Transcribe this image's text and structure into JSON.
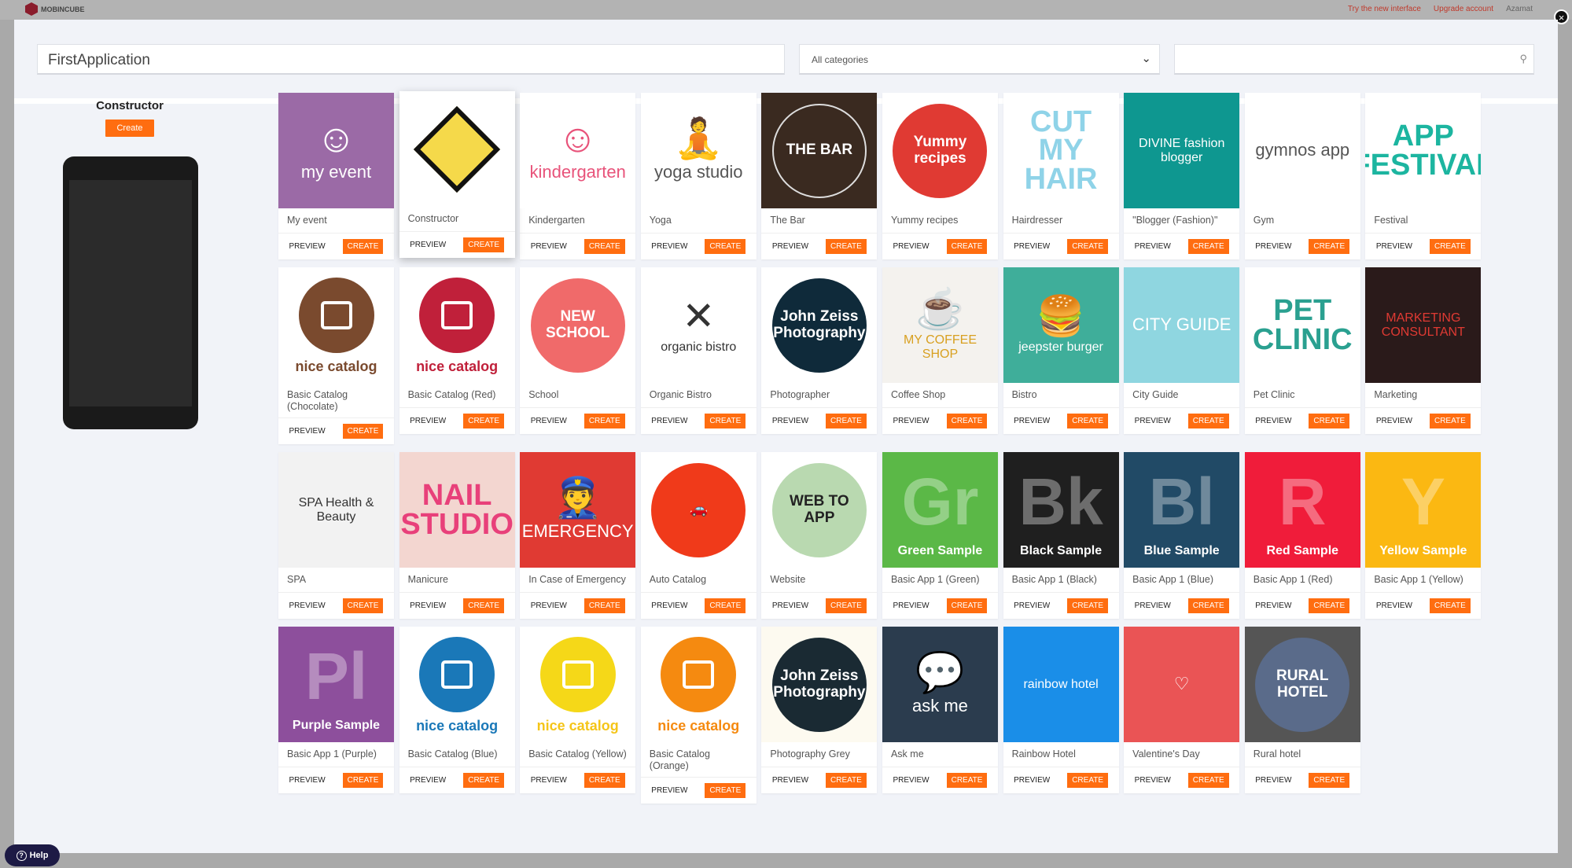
{
  "topbar": {
    "brand": "MOBINCUBE",
    "try_new": "Try the new interface",
    "upgrade": "Upgrade account",
    "user": "Azamat"
  },
  "header": {
    "app_name": "FirstApplication",
    "category": "All categories",
    "search_placeholder": ""
  },
  "left": {
    "title": "Constructor",
    "create": "Create"
  },
  "help": "Help",
  "buttons": {
    "preview": "PREVIEW",
    "create": "CREATE"
  },
  "accent": "#ff6d10",
  "cards": [
    {
      "title": "My event",
      "thumb": {
        "bg": "#9b6aa6",
        "kind": "text",
        "text": "my event",
        "color": "#fff",
        "icon": "☺"
      }
    },
    {
      "title": "Constructor",
      "raised": true,
      "thumb": {
        "bg": "#fff",
        "kind": "diamond",
        "text": "",
        "color": "#111"
      }
    },
    {
      "title": "Kindergarten",
      "thumb": {
        "bg": "#fff",
        "kind": "text",
        "text": "kindergarten",
        "color": "#e8537a",
        "icon": "☺"
      }
    },
    {
      "title": "Yoga",
      "thumb": {
        "bg": "#fff",
        "kind": "text",
        "text": "yoga studio",
        "color": "#555",
        "icon": "🧘"
      }
    },
    {
      "title": "The Bar",
      "thumb": {
        "bg": "#3a2a20",
        "kind": "circle",
        "circle": "transparent",
        "text": "THE BAR",
        "color": "#fff"
      }
    },
    {
      "title": "Yummy recipes",
      "thumb": {
        "bg": "#fff",
        "kind": "circle",
        "circle": "#e03a33",
        "text": "Yummy recipes",
        "color": "#fff"
      }
    },
    {
      "title": "Hairdresser",
      "thumb": {
        "bg": "#fff",
        "kind": "big",
        "text": "CUT MY HAIR",
        "color": "#8fd3e8"
      }
    },
    {
      "title": "\"Blogger (Fashion)\"",
      "thumb": {
        "bg": "#0e9790",
        "kind": "text",
        "text": "DIVINE fashion blogger",
        "color": "#fff"
      }
    },
    {
      "title": "Gym",
      "thumb": {
        "bg": "#fff",
        "kind": "text",
        "text": "gymnos app",
        "color": "#555"
      }
    },
    {
      "title": "Festival",
      "thumb": {
        "bg": "#fff",
        "kind": "big",
        "text": "APP FESTIVAL",
        "color": "#1cb5a0"
      }
    },
    {
      "title": "Basic Catalog (Chocolate)",
      "thumb": {
        "bg": "#fff",
        "kind": "catalog",
        "circle": "#7a4a2e",
        "text": "nice catalog",
        "color": "#7a4a2e"
      }
    },
    {
      "title": "Basic Catalog (Red)",
      "thumb": {
        "bg": "#fff",
        "kind": "catalog",
        "circle": "#c0203a",
        "text": "nice catalog",
        "color": "#c0203a"
      }
    },
    {
      "title": "School",
      "thumb": {
        "bg": "#fff",
        "kind": "circle",
        "circle": "#f06a6a",
        "text": "NEW SCHOOL",
        "color": "#fff"
      }
    },
    {
      "title": "Organic Bistro",
      "thumb": {
        "bg": "#fff",
        "kind": "text",
        "text": "organic bistro",
        "color": "#333",
        "icon": "✕"
      }
    },
    {
      "title": "Photographer",
      "thumb": {
        "bg": "#fff",
        "kind": "circle",
        "circle": "#0f2a3a",
        "text": "John Zeiss Photography",
        "color": "#fff"
      }
    },
    {
      "title": "Coffee Shop",
      "thumb": {
        "bg": "#f4f2ee",
        "kind": "text",
        "text": "MY COFFEE SHOP",
        "color": "#d8a020",
        "icon": "☕"
      }
    },
    {
      "title": "Bistro",
      "thumb": {
        "bg": "#3fae9a",
        "kind": "text",
        "text": "jeepster burger",
        "color": "#fff",
        "icon": "🍔"
      }
    },
    {
      "title": "City Guide",
      "thumb": {
        "bg": "#8fd6e0",
        "kind": "text",
        "text": "CITY GUIDE",
        "color": "#fff"
      }
    },
    {
      "title": "Pet Clinic",
      "thumb": {
        "bg": "#fff",
        "kind": "big",
        "text": "PET CLINIC",
        "color": "#2aa090"
      }
    },
    {
      "title": "Marketing",
      "thumb": {
        "bg": "#2a1a1a",
        "kind": "text",
        "text": "MARKETING CONSULTANT",
        "color": "#e03a33"
      }
    },
    {
      "title": "SPA",
      "thumb": {
        "bg": "#f2f2f2",
        "kind": "text",
        "text": "SPA Health & Beauty",
        "color": "#333"
      }
    },
    {
      "title": "Manicure",
      "thumb": {
        "bg": "#f3d6d0",
        "kind": "big",
        "text": "NAIL STUDIO",
        "color": "#e8407a"
      }
    },
    {
      "title": "In Case of Emergency",
      "thumb": {
        "bg": "#e03a33",
        "kind": "text",
        "text": "EMERGENCY",
        "color": "#fff",
        "icon": "👮"
      }
    },
    {
      "title": "Auto Catalog",
      "thumb": {
        "bg": "#fff",
        "kind": "circle",
        "circle": "#f03a1a",
        "text": "🚗",
        "color": "#fff"
      }
    },
    {
      "title": "Website",
      "thumb": {
        "bg": "#fff",
        "kind": "circle",
        "circle": "#b9d9b0",
        "text": "WEB TO APP",
        "color": "#222"
      }
    },
    {
      "title": "Basic App 1 (Green)",
      "thumb": {
        "bg": "#5bb847",
        "kind": "letter",
        "letter": "Gr",
        "text": "Green Sample",
        "color": "#fff"
      }
    },
    {
      "title": "Basic App 1 (Black)",
      "thumb": {
        "bg": "#1f1f1f",
        "kind": "letter",
        "letter": "Bk",
        "text": "Black Sample",
        "color": "#fff"
      }
    },
    {
      "title": "Basic App 1 (Blue)",
      "thumb": {
        "bg": "#214a66",
        "kind": "letter",
        "letter": "Bl",
        "text": "Blue Sample",
        "color": "#fff"
      }
    },
    {
      "title": "Basic App 1 (Red)",
      "thumb": {
        "bg": "#f01c3a",
        "kind": "letter",
        "letter": "R",
        "text": "Red Sample",
        "color": "#fff"
      }
    },
    {
      "title": "Basic App 1 (Yellow)",
      "thumb": {
        "bg": "#fbb812",
        "kind": "letter",
        "letter": "Y",
        "text": "Yellow Sample",
        "color": "#fff"
      }
    },
    {
      "title": "Basic App 1 (Purple)",
      "thumb": {
        "bg": "#8d4f9c",
        "kind": "letter",
        "letter": "Pl",
        "text": "Purple Sample",
        "color": "#fff"
      }
    },
    {
      "title": "Basic Catalog (Blue)",
      "thumb": {
        "bg": "#fff",
        "kind": "catalog",
        "circle": "#1a78b8",
        "text": "nice catalog",
        "color": "#1a78b8"
      }
    },
    {
      "title": "Basic Catalog (Yellow)",
      "thumb": {
        "bg": "#fff",
        "kind": "catalog",
        "circle": "#f5d818",
        "text": "nice catalog",
        "color": "#f5c518"
      }
    },
    {
      "title": "Basic Catalog (Orange)",
      "thumb": {
        "bg": "#fff",
        "kind": "catalog",
        "circle": "#f58a10",
        "text": "nice catalog",
        "color": "#f58a10"
      }
    },
    {
      "title": "Photography Grey",
      "thumb": {
        "bg": "#fdfaf0",
        "kind": "circle",
        "circle": "#1a2a33",
        "text": "John Zeiss Photography",
        "color": "#fff"
      }
    },
    {
      "title": "Ask me",
      "thumb": {
        "bg": "#2b3c4e",
        "kind": "text",
        "text": "ask me",
        "color": "#fff",
        "icon": "💬"
      }
    },
    {
      "title": "Rainbow Hotel",
      "thumb": {
        "bg": "#1a8ee8",
        "kind": "text",
        "text": "rainbow hotel",
        "color": "#fff"
      }
    },
    {
      "title": "Valentine's Day",
      "thumb": {
        "bg": "#ea5455",
        "kind": "text",
        "text": "♡",
        "color": "#fff"
      }
    },
    {
      "title": "Rural hotel",
      "thumb": {
        "bg": "#555",
        "kind": "circle",
        "circle": "#5a6b8a",
        "text": "RURAL HOTEL",
        "color": "#fff"
      }
    }
  ]
}
